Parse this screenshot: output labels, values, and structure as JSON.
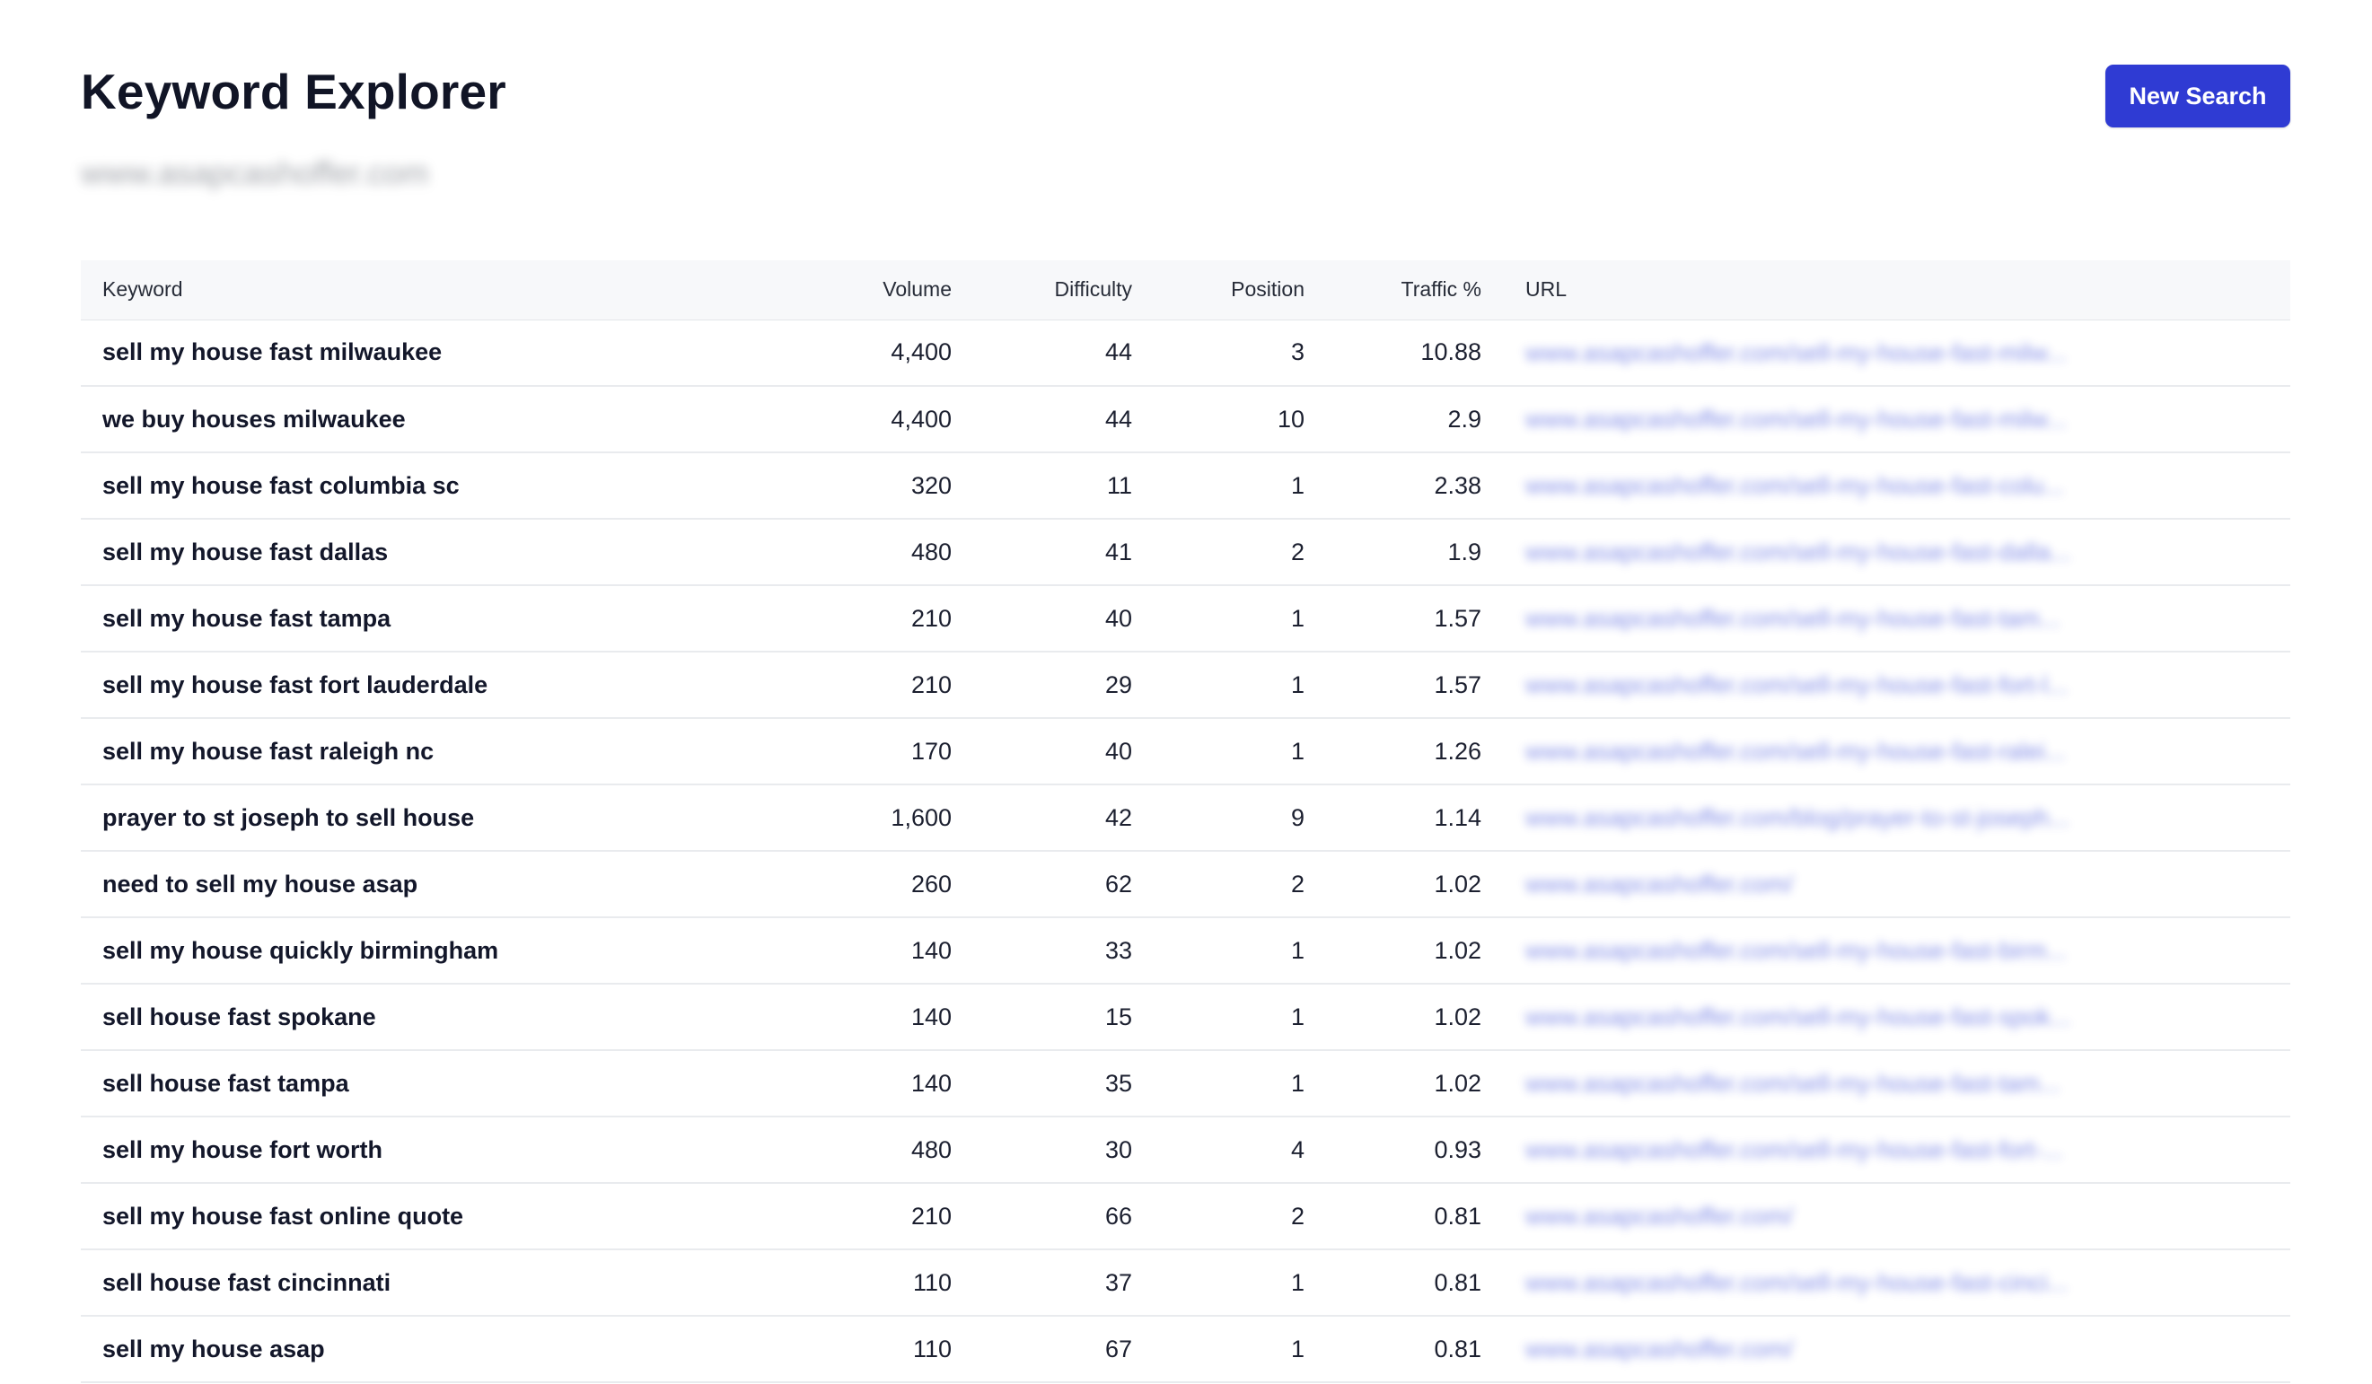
{
  "header": {
    "title": "Keyword Explorer",
    "domain": "www.asapcashoffer.com",
    "new_search_label": "New Search"
  },
  "table": {
    "columns": [
      "Keyword",
      "Volume",
      "Difficulty",
      "Position",
      "Traffic %",
      "URL"
    ],
    "rows": [
      {
        "keyword": "sell my house fast milwaukee",
        "volume": "4,400",
        "difficulty": "44",
        "position": "3",
        "traffic": "10.88",
        "url": "www.asapcashoffer.com/sell-my-house-fast-milw..."
      },
      {
        "keyword": "we buy houses milwaukee",
        "volume": "4,400",
        "difficulty": "44",
        "position": "10",
        "traffic": "2.9",
        "url": "www.asapcashoffer.com/sell-my-house-fast-milw..."
      },
      {
        "keyword": "sell my house fast columbia sc",
        "volume": "320",
        "difficulty": "11",
        "position": "1",
        "traffic": "2.38",
        "url": "www.asapcashoffer.com/sell-my-house-fast-colu..."
      },
      {
        "keyword": "sell my house fast dallas",
        "volume": "480",
        "difficulty": "41",
        "position": "2",
        "traffic": "1.9",
        "url": "www.asapcashoffer.com/sell-my-house-fast-dalla..."
      },
      {
        "keyword": "sell my house fast tampa",
        "volume": "210",
        "difficulty": "40",
        "position": "1",
        "traffic": "1.57",
        "url": "www.asapcashoffer.com/sell-my-house-fast-tam..."
      },
      {
        "keyword": "sell my house fast fort lauderdale",
        "volume": "210",
        "difficulty": "29",
        "position": "1",
        "traffic": "1.57",
        "url": "www.asapcashoffer.com/sell-my-house-fast-fort-l..."
      },
      {
        "keyword": "sell my house fast raleigh nc",
        "volume": "170",
        "difficulty": "40",
        "position": "1",
        "traffic": "1.26",
        "url": "www.asapcashoffer.com/sell-my-house-fast-ralei..."
      },
      {
        "keyword": "prayer to st joseph to sell house",
        "volume": "1,600",
        "difficulty": "42",
        "position": "9",
        "traffic": "1.14",
        "url": "www.asapcashoffer.com/blog/prayer-to-st-joseph..."
      },
      {
        "keyword": "need to sell my house asap",
        "volume": "260",
        "difficulty": "62",
        "position": "2",
        "traffic": "1.02",
        "url": "www.asapcashoffer.com/"
      },
      {
        "keyword": "sell my house quickly birmingham",
        "volume": "140",
        "difficulty": "33",
        "position": "1",
        "traffic": "1.02",
        "url": "www.asapcashoffer.com/sell-my-house-fast-birm..."
      },
      {
        "keyword": "sell house fast spokane",
        "volume": "140",
        "difficulty": "15",
        "position": "1",
        "traffic": "1.02",
        "url": "www.asapcashoffer.com/sell-my-house-fast-spok..."
      },
      {
        "keyword": "sell house fast tampa",
        "volume": "140",
        "difficulty": "35",
        "position": "1",
        "traffic": "1.02",
        "url": "www.asapcashoffer.com/sell-my-house-fast-tam..."
      },
      {
        "keyword": "sell my house fort worth",
        "volume": "480",
        "difficulty": "30",
        "position": "4",
        "traffic": "0.93",
        "url": "www.asapcashoffer.com/sell-my-house-fast-fort-..."
      },
      {
        "keyword": "sell my house fast online quote",
        "volume": "210",
        "difficulty": "66",
        "position": "2",
        "traffic": "0.81",
        "url": "www.asapcashoffer.com/"
      },
      {
        "keyword": "sell house fast cincinnati",
        "volume": "110",
        "difficulty": "37",
        "position": "1",
        "traffic": "0.81",
        "url": "www.asapcashoffer.com/sell-my-house-fast-cinci..."
      },
      {
        "keyword": "sell my house asap",
        "volume": "110",
        "difficulty": "67",
        "position": "1",
        "traffic": "0.81",
        "url": "www.asapcashoffer.com/"
      }
    ]
  },
  "colors": {
    "accent": "#2f3bd3",
    "header_bg": "#f7f8fa",
    "link": "#3446d8"
  }
}
